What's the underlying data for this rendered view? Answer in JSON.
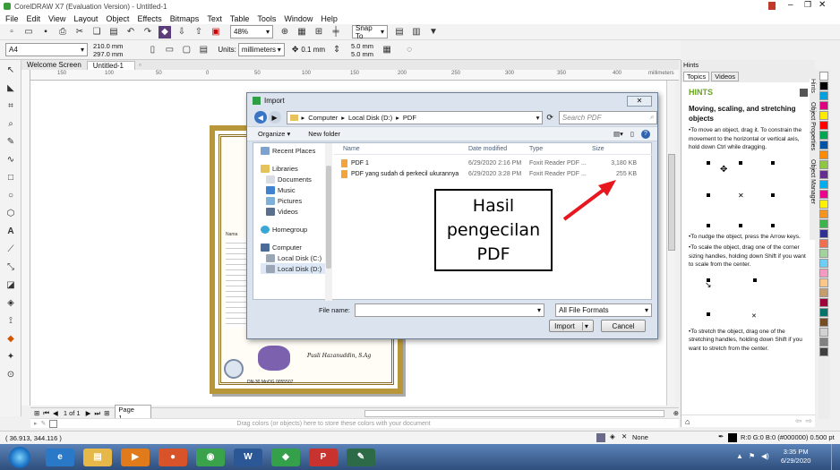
{
  "app": {
    "title": "CorelDRAW X7 (Evaluation Version) - Untitled-1",
    "menu": [
      "File",
      "Edit",
      "View",
      "Layout",
      "Object",
      "Effects",
      "Bitmaps",
      "Text",
      "Table",
      "Tools",
      "Window",
      "Help"
    ],
    "zoom": "48%",
    "snap_to": "Snap To",
    "page_size": "A4",
    "width": "210.0 mm",
    "height": "297.0 mm",
    "units_label": "Units:",
    "units_value": "millimeters",
    "nudge": "0.1 mm",
    "dup_x": "5.0 mm",
    "dup_y": "5.0 mm"
  },
  "tabs": {
    "welcome": "Welcome Screen",
    "doc": "Untitled-1"
  },
  "ruler": {
    "labels": [
      "150",
      "100",
      "50",
      "0",
      "50",
      "100",
      "150",
      "200",
      "250",
      "300",
      "350",
      "400"
    ],
    "unit": "millimeters"
  },
  "document": {
    "signature": "Pusli Hazanuddin, S.Ag",
    "serial": "DN-30 MnOG   0055507",
    "label": "Nama"
  },
  "page_nav": {
    "page_count": "1 of 1",
    "page_tab": "Page 1",
    "drag_hint": "Drag colors (or objects) here to store these colors with your document"
  },
  "status": {
    "coords": "( 36.913, 344.116 )",
    "fill": "None",
    "outline": "R:0 G:0 B:0 (#000000) 0.500 pt"
  },
  "hints_panel": {
    "title": "Hints",
    "tab_topics": "Topics",
    "tab_videos": "Videos",
    "heading": "HINTS",
    "subheading": "Moving, scaling, and stretching objects",
    "p1": "•To move an object, drag it. To constrain the movement to the horizontal or vertical axis, hold down Ctrl while dragging.",
    "p2": "•To nudge the object, press the Arrow keys.",
    "p3": "•To scale the object, drag one of the corner sizing handles, holding down Shift if you want to scale from the center.",
    "p4": "•To stretch the object, drag one of the stretching handles, holding down Shift if you want to stretch from the center.",
    "side_tabs": [
      "Hints",
      "Object Properties",
      "Object Manager"
    ]
  },
  "dialog": {
    "title": "Import",
    "breadcrumb": [
      "Computer",
      "Local Disk (D:)",
      "PDF"
    ],
    "search_placeholder": "Search PDF",
    "organize": "Organize",
    "new_folder": "New folder",
    "nav": [
      "Recent Places",
      "Libraries",
      "Documents",
      "Music",
      "Pictures",
      "Videos",
      "Homegroup",
      "Computer",
      "Local Disk (C:)",
      "Local Disk (D:)"
    ],
    "columns": {
      "name": "Name",
      "date": "Date modified",
      "type": "Type",
      "size": "Size"
    },
    "files": [
      {
        "name": "PDF 1",
        "date": "6/29/2020 2:16 PM",
        "type": "Foxit Reader PDF ...",
        "size": "3,180 KB"
      },
      {
        "name": "PDF yang sudah di perkecil ukurannya",
        "date": "6/29/2020 3:28 PM",
        "type": "Foxit Reader PDF ...",
        "size": "255 KB"
      }
    ],
    "filename_label": "File name:",
    "filename_value": "",
    "format": "All File Formats",
    "import_btn": "Import",
    "cancel_btn": "Cancel"
  },
  "annotation": {
    "text": "Hasil pengecilan PDF"
  },
  "taskbar": {
    "time": "3:35 PM",
    "date": "6/29/2020"
  },
  "colors": {
    "palette": [
      "#ffffff",
      "#000000",
      "#00a0e0",
      "#e0007f",
      "#ffeb00",
      "#ff0000",
      "#00a651",
      "#0054a6",
      "#ff8c00",
      "#8dc63f",
      "#662d91",
      "#00aeef",
      "#ec008c",
      "#fff200",
      "#f7941d",
      "#39b54a",
      "#2e3192",
      "#f26c4f",
      "#a3d39c",
      "#6dcff6",
      "#f49ac1",
      "#fdc689",
      "#c69c6d",
      "#9e0039",
      "#00746b",
      "#754c24",
      "#d2d2d2",
      "#808080",
      "#404040"
    ]
  }
}
